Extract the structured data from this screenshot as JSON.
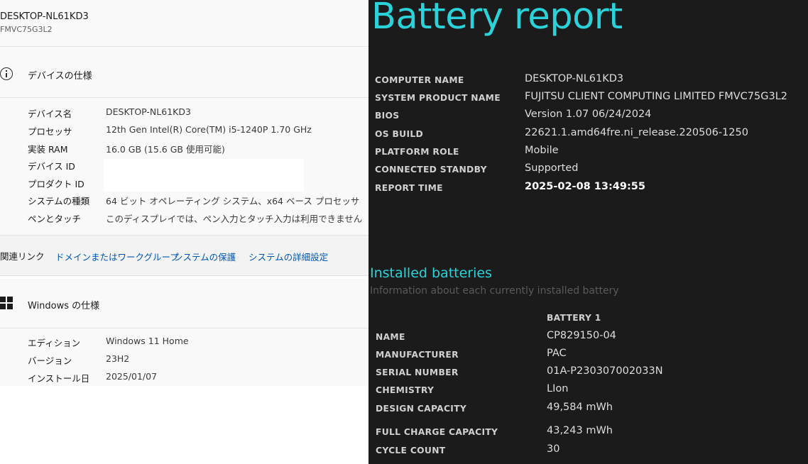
{
  "settings": {
    "device_header": {
      "name": "DESKTOP-NL61KD3",
      "model": "FMVC75G3L2"
    },
    "device_spec": {
      "title": "デバイスの仕様",
      "rows": [
        {
          "label": "デバイス名",
          "value": "DESKTOP-NL61KD3"
        },
        {
          "label": "プロセッサ",
          "value": "12th Gen Intel(R) Core(TM) i5-1240P   1.70 GHz"
        },
        {
          "label": "実装 RAM",
          "value": "16.0 GB (15.6 GB 使用可能)"
        },
        {
          "label": "デバイス ID",
          "value": ""
        },
        {
          "label": "プロダクト ID",
          "value": ""
        },
        {
          "label": "システムの種類",
          "value": "64 ビット オペレーティング システム、x64 ベース プロセッサ"
        },
        {
          "label": "ペンとタッチ",
          "value": "このディスプレイでは、ペン入力とタッチ入力は利用できません"
        }
      ]
    },
    "related_links": {
      "label": "関連リンク",
      "links": [
        "ドメインまたはワークグループ",
        "システムの保護",
        "システムの詳細設定"
      ]
    },
    "windows_spec": {
      "title": "Windows の仕様",
      "rows": [
        {
          "label": "エディション",
          "value": "Windows 11 Home"
        },
        {
          "label": "バージョン",
          "value": "23H2"
        },
        {
          "label": "インストール日",
          "value": "2025/01/07"
        }
      ]
    },
    "icons": {
      "device_spec": "info-icon",
      "windows_spec": "windows-logo-icon"
    }
  },
  "battery_report": {
    "title": "Battery report",
    "accent_color": "#2ad2d9",
    "info": [
      {
        "key": "COMPUTER NAME",
        "value": "DESKTOP-NL61KD3"
      },
      {
        "key": "SYSTEM PRODUCT NAME",
        "value": "FUJITSU CLIENT COMPUTING LIMITED FMVC75G3L2"
      },
      {
        "key": "BIOS",
        "value": "Version 1.07 06/24/2024"
      },
      {
        "key": "OS BUILD",
        "value": "22621.1.amd64fre.ni_release.220506-1250"
      },
      {
        "key": "PLATFORM ROLE",
        "value": "Mobile"
      },
      {
        "key": "CONNECTED STANDBY",
        "value": "Supported"
      },
      {
        "key": "REPORT TIME",
        "value": "2025-02-08  13:49:55"
      }
    ],
    "installed": {
      "title": "Installed batteries",
      "subtitle": "Information about each currently installed battery",
      "battery_label": "BATTERY 1",
      "rows": [
        {
          "key": "NAME",
          "value": "CP829150-04"
        },
        {
          "key": "MANUFACTURER",
          "value": "PAC"
        },
        {
          "key": "SERIAL NUMBER",
          "value": "01A-P230307002033N"
        },
        {
          "key": "CHEMISTRY",
          "value": "LIon"
        },
        {
          "key": "DESIGN CAPACITY",
          "value": "49,584 mWh"
        },
        {
          "key": "FULL CHARGE CAPACITY",
          "value": "43,243 mWh"
        },
        {
          "key": "CYCLE COUNT",
          "value": "30"
        }
      ]
    }
  }
}
